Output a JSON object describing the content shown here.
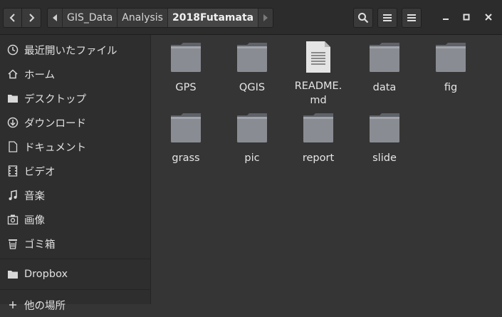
{
  "path": {
    "segments": [
      "GIS_Data",
      "Analysis",
      "2018Futamata"
    ]
  },
  "sidebar": {
    "items": [
      {
        "label": "最近開いたファイル",
        "icon": "recent-icon"
      },
      {
        "label": "ホーム",
        "icon": "home-icon"
      },
      {
        "label": "デスクトップ",
        "icon": "desktop-folder-icon"
      },
      {
        "label": "ダウンロード",
        "icon": "download-icon"
      },
      {
        "label": "ドキュメント",
        "icon": "document-icon"
      },
      {
        "label": "ビデオ",
        "icon": "video-icon"
      },
      {
        "label": "音楽",
        "icon": "music-icon"
      },
      {
        "label": "画像",
        "icon": "picture-icon"
      },
      {
        "label": "ゴミ箱",
        "icon": "trash-icon"
      },
      {
        "label": "Dropbox",
        "icon": "folder-icon"
      },
      {
        "label": "他の場所",
        "icon": "plus-icon"
      }
    ]
  },
  "files": [
    {
      "name": "GPS",
      "type": "folder"
    },
    {
      "name": "QGIS",
      "type": "folder"
    },
    {
      "name": "README.\nmd",
      "type": "text"
    },
    {
      "name": "data",
      "type": "folder"
    },
    {
      "name": "fig",
      "type": "folder"
    },
    {
      "name": "grass",
      "type": "folder"
    },
    {
      "name": "pic",
      "type": "folder"
    },
    {
      "name": "report",
      "type": "folder"
    },
    {
      "name": "slide",
      "type": "folder"
    }
  ]
}
